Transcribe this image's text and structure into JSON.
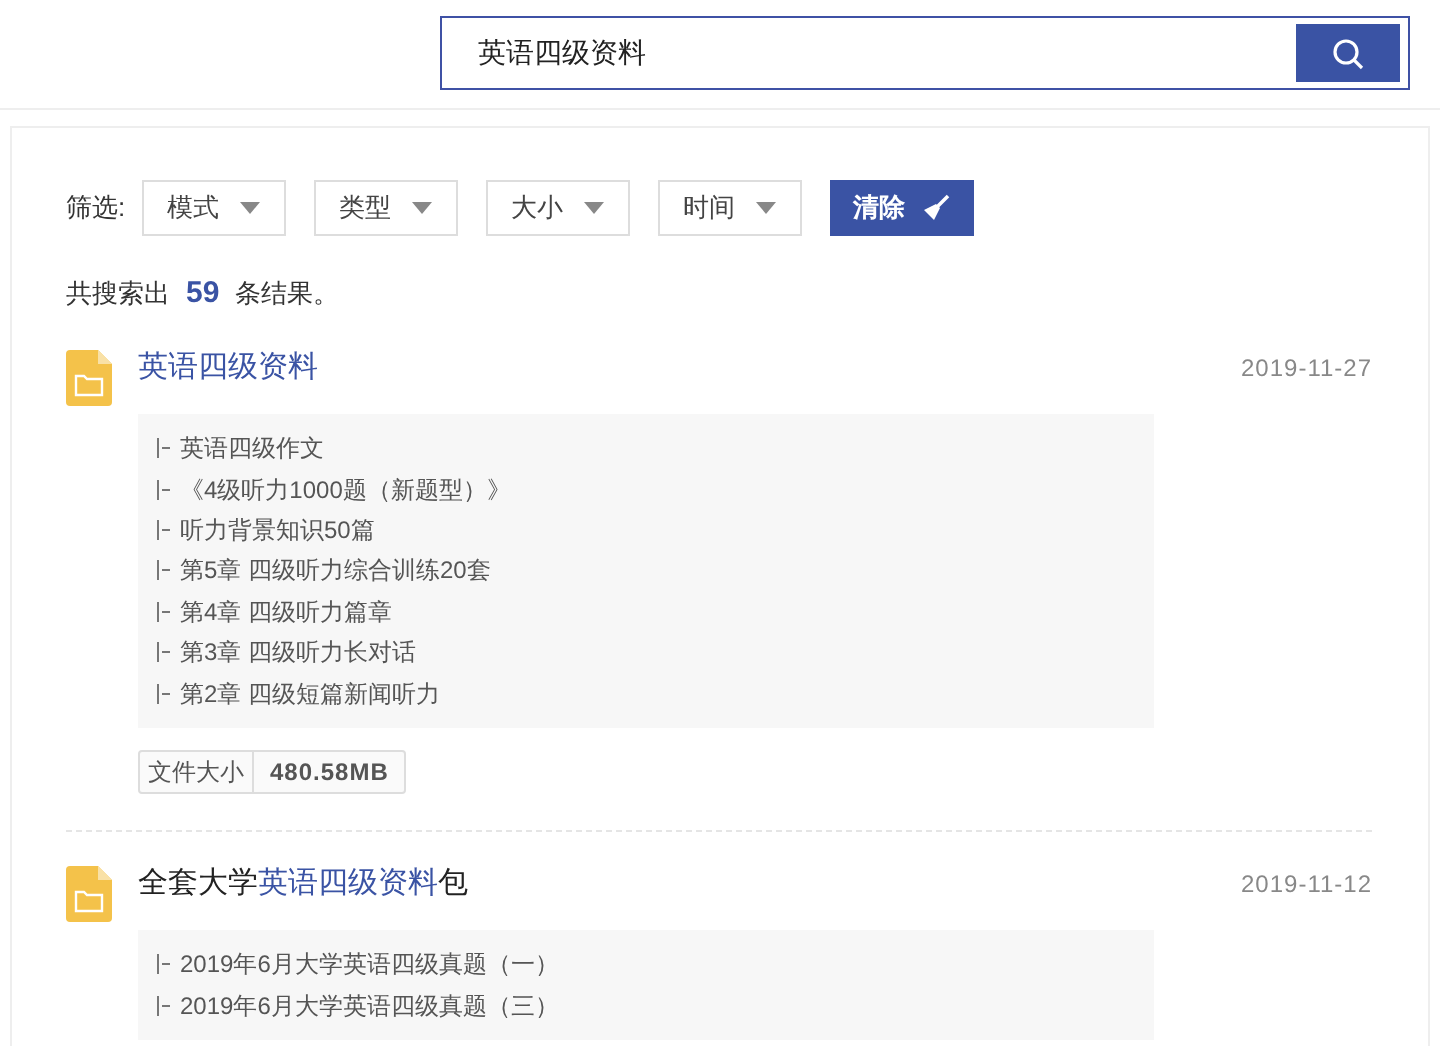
{
  "search": {
    "value": "英语四级资料"
  },
  "filter": {
    "label": "筛选:",
    "dropdowns": [
      "模式",
      "类型",
      "大小",
      "时间"
    ],
    "clear_button": "清除"
  },
  "summary": {
    "prefix": "共搜索出",
    "count": "59",
    "suffix": "条结果。"
  },
  "results": [
    {
      "title": [
        {
          "text": "英语四级资料",
          "highlight": true
        }
      ],
      "date": "2019-11-27",
      "files": [
        "英语四级作文",
        "《4级听力1000题（新题型）》",
        "听力背景知识50篇",
        "第5章 四级听力综合训练20套",
        "第4章 四级听力篇章",
        "第3章 四级听力长对话",
        "第2章 四级短篇新闻听力"
      ],
      "size_label": "文件大小",
      "size": "480.58MB"
    },
    {
      "title": [
        {
          "text": "全套大学",
          "highlight": false
        },
        {
          "text": "英语四级资料",
          "highlight": true
        },
        {
          "text": "包",
          "highlight": false
        }
      ],
      "date": "2019-11-12",
      "files": [
        "2019年6月大学英语四级真题（一）",
        "2019年6月大学英语四级真题（三）"
      ]
    }
  ]
}
